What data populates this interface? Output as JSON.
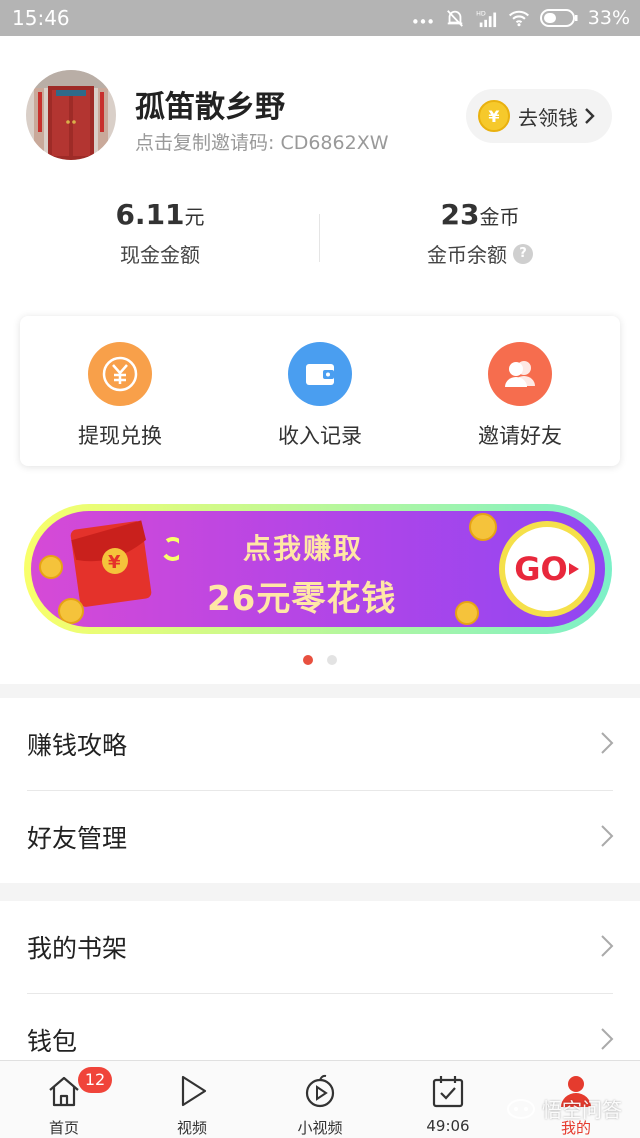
{
  "status_bar": {
    "time": "15:46",
    "battery": "33%",
    "icons": [
      "more-dots-icon",
      "alarm-off-icon",
      "hd-signal-icon",
      "wifi-icon",
      "battery-icon"
    ]
  },
  "profile": {
    "username": "孤笛散乡野",
    "invite_text": "点击复制邀请码: CD6862XW",
    "get_money_label": "去领钱",
    "coin_symbol": "¥"
  },
  "balances": {
    "cash": {
      "value": "6.11",
      "unit": "元",
      "label": "现金金额"
    },
    "coins": {
      "value": "23",
      "unit": "金币",
      "label": "金币余额",
      "help": "?"
    }
  },
  "actions": [
    {
      "label": "提现兑换",
      "icon": "yuan-icon",
      "color": "#f8a04a"
    },
    {
      "label": "收入记录",
      "icon": "wallet-icon",
      "color": "#4a9ef0"
    },
    {
      "label": "邀请好友",
      "icon": "friends-icon",
      "color": "#f66d4e"
    }
  ],
  "banner": {
    "line1": "点我赚取",
    "line2": "26元零花钱",
    "button": "GO",
    "envelope_symbol": "¥"
  },
  "carousel": {
    "pages": 2,
    "active_index": 0
  },
  "menu_group1": [
    {
      "label": "赚钱攻略"
    },
    {
      "label": "好友管理"
    }
  ],
  "menu_group2": [
    {
      "label": "我的书架"
    },
    {
      "label": "钱包"
    }
  ],
  "bottom_nav": [
    {
      "label": "首页",
      "icon": "home-icon",
      "badge": "12"
    },
    {
      "label": "视频",
      "icon": "play-icon"
    },
    {
      "label": "小视频",
      "icon": "short-video-icon"
    },
    {
      "label": "49:06",
      "icon": "checkin-calendar-icon"
    },
    {
      "label": "我的",
      "icon": "user-icon",
      "active": true
    }
  ],
  "watermark": "悟空问答",
  "colors": {
    "accent": "#e53b2e",
    "badge": "#f0443a",
    "coin": "#f6c92b"
  }
}
